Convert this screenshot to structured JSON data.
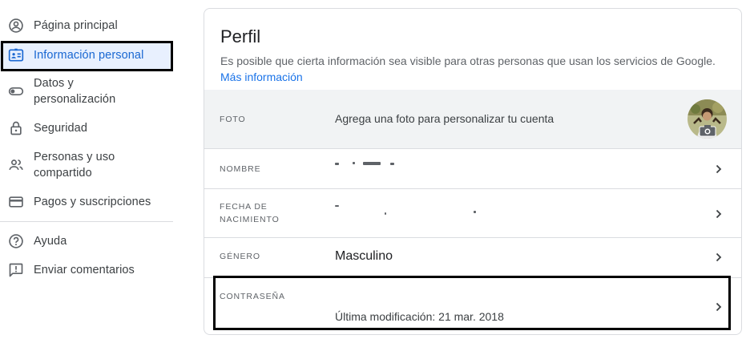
{
  "sidebar": {
    "items": [
      {
        "label": "Página principal",
        "icon": "account-circle-icon"
      },
      {
        "label": "Información personal",
        "icon": "id-card-icon",
        "active": true
      },
      {
        "label": "Datos y personalización",
        "line1": "Datos y",
        "line2": "personalización",
        "icon": "toggle-icon"
      },
      {
        "label": "Seguridad",
        "icon": "lock-icon"
      },
      {
        "label": "Personas y uso compartido",
        "line1": "Personas y uso",
        "line2": "compartido",
        "icon": "people-icon"
      },
      {
        "label": "Pagos y suscripciones",
        "icon": "credit-card-icon"
      }
    ],
    "footer_items": [
      {
        "label": "Ayuda",
        "icon": "help-icon"
      },
      {
        "label": "Enviar comentarios",
        "icon": "feedback-icon"
      }
    ]
  },
  "profile": {
    "title": "Perfil",
    "description": "Es posible que cierta información sea visible para otras personas que usan los servicios de Google.",
    "more_link": "Más información",
    "rows": {
      "photo": {
        "label": "FOTO",
        "value": "Agrega una foto para personalizar tu cuenta"
      },
      "name": {
        "label": "NOMBRE"
      },
      "birthdate": {
        "label_line1": "FECHA DE",
        "label_line2": "NACIMIENTO"
      },
      "gender": {
        "label": "GÉNERO",
        "value": "Masculino"
      },
      "password": {
        "label": "CONTRASEÑA",
        "value": "Última modificación: 21 mar. 2018"
      }
    }
  },
  "colors": {
    "accent": "#1a73e8",
    "active_bg": "#e8f0fe",
    "active_text": "#1967d2",
    "row_highlight": "#f1f3f4",
    "divider": "#dadce0"
  }
}
